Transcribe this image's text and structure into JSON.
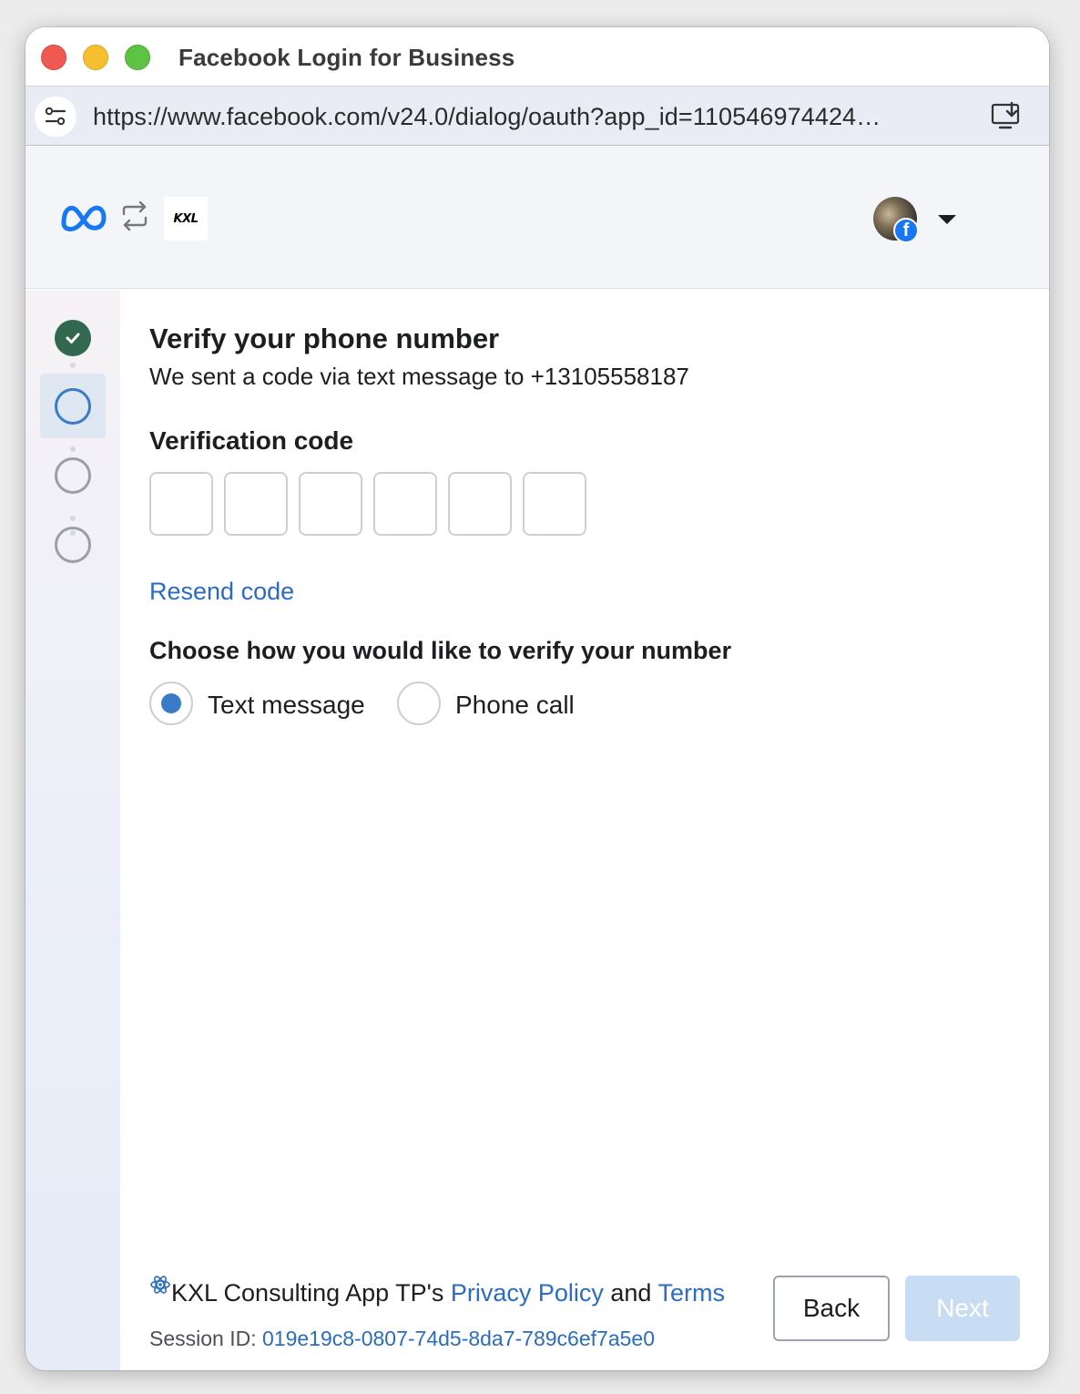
{
  "window": {
    "title": "Facebook Login for Business"
  },
  "address_bar": {
    "url": "https://www.facebook.com/v24.0/dialog/oauth?app_id=110546974424…",
    "left_icon": "tune-icon",
    "right_icon": "install-app-icon"
  },
  "header": {
    "meta_logo": "meta-logo",
    "swap_icon": "swap-arrows-icon",
    "app_logo_text": "KXL",
    "account_badge": "f"
  },
  "stepper": {
    "steps": [
      "completed",
      "current",
      "pending",
      "pending"
    ]
  },
  "form": {
    "title": "Verify your phone number",
    "subtitle": "We sent a code via text message to +13105558187",
    "code_label": "Verification code",
    "code_digits": [
      "",
      "",
      "",
      "",
      "",
      ""
    ],
    "resend_label": "Resend code",
    "method_prompt": "Choose how you would like to verify your number",
    "methods": [
      {
        "label": "Text message",
        "selected": true
      },
      {
        "label": "Phone call",
        "selected": false
      }
    ]
  },
  "footer": {
    "app_name_prefix": "KXL Consulting App TP's ",
    "privacy_label": "Privacy Policy",
    "and_text": " and ",
    "terms_label": "Terms",
    "session_label": "Session ID: ",
    "session_id": "019e19c8-0807-74d5-8da7-789c6ef7a5e0",
    "back_label": "Back",
    "next_label": "Next"
  },
  "colors": {
    "link": "#2a6cc2",
    "done_step": "#31684f",
    "active_step": "#3a7bc8",
    "next_disabled": "#c8dcf4",
    "facebook_blue": "#1877f2"
  }
}
